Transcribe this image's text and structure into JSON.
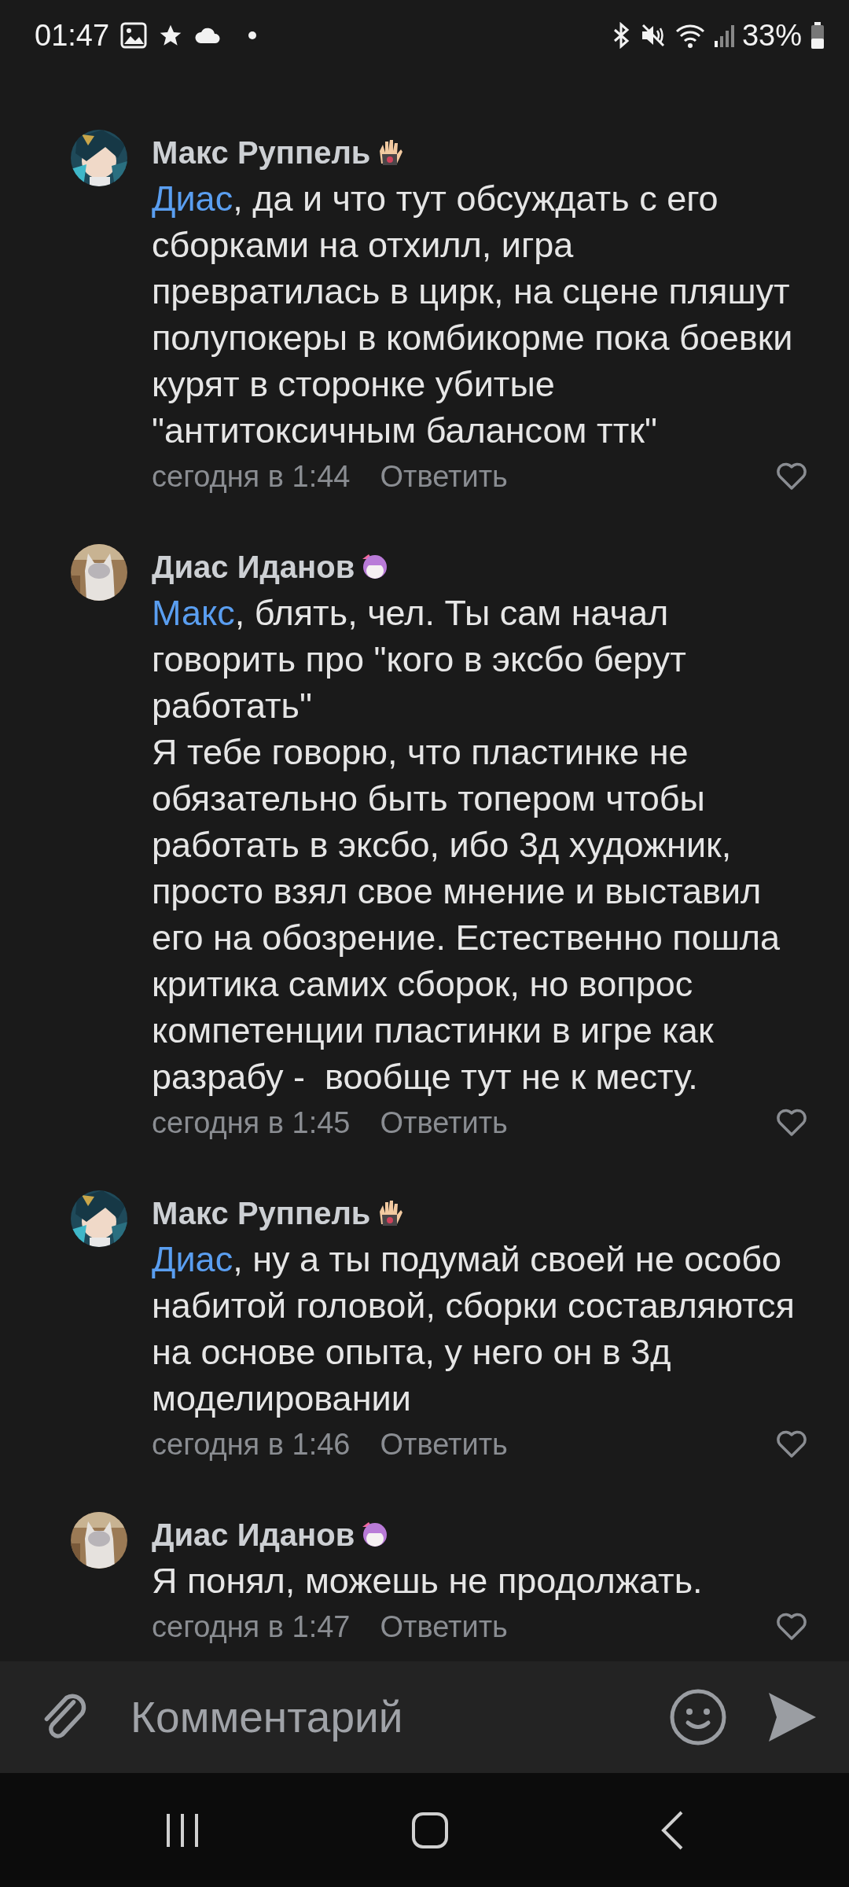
{
  "status_bar": {
    "time": "01:47",
    "battery": "33%"
  },
  "comments": [
    {
      "kind": "character",
      "author": "Макс Руппель",
      "mention": "Диас",
      "text": ", да и что тут обсуждать с его сборками на отхилл, игра превратилась в цирк, на сцене пляшут полупокеры в комбикорме пока боевки курят в сторонке убитые \"антитоксичным балансом ттк\"",
      "time": "сегодня в 1:44",
      "reply": "Ответить",
      "liked": false
    },
    {
      "kind": "cat",
      "author": "Диас Иданов",
      "mention": "Макс",
      "text": ", блять, чел. Ты сам начал говорить про \"кого в эксбо берут работать\"\nЯ тебе говорю, что пластинке не обязательно быть топером чтобы работать в эксбо, ибо 3д художник, просто взял свое мнение и выставил его на обозрение. Естественно пошла критика самих сборок, но вопрос компетенции пластинки в игре как разрабу -  вообще тут не к месту.",
      "time": "сегодня в 1:45",
      "reply": "Ответить",
      "liked": false
    },
    {
      "kind": "character",
      "author": "Макс Руппель",
      "mention": "Диас",
      "text": ", ну а ты подумай своей не особо набитой головой, сборки составляются на основе опыта, у него он в 3д моделировании",
      "time": "сегодня в 1:46",
      "reply": "Ответить",
      "liked": false
    },
    {
      "kind": "cat",
      "author": "Диас Иданов",
      "text": "Я понял, можешь не продолжать.",
      "time": "сегодня в 1:47",
      "reply": "Ответить",
      "liked": false
    }
  ],
  "comment_input": {
    "placeholder": "Комментарий"
  }
}
